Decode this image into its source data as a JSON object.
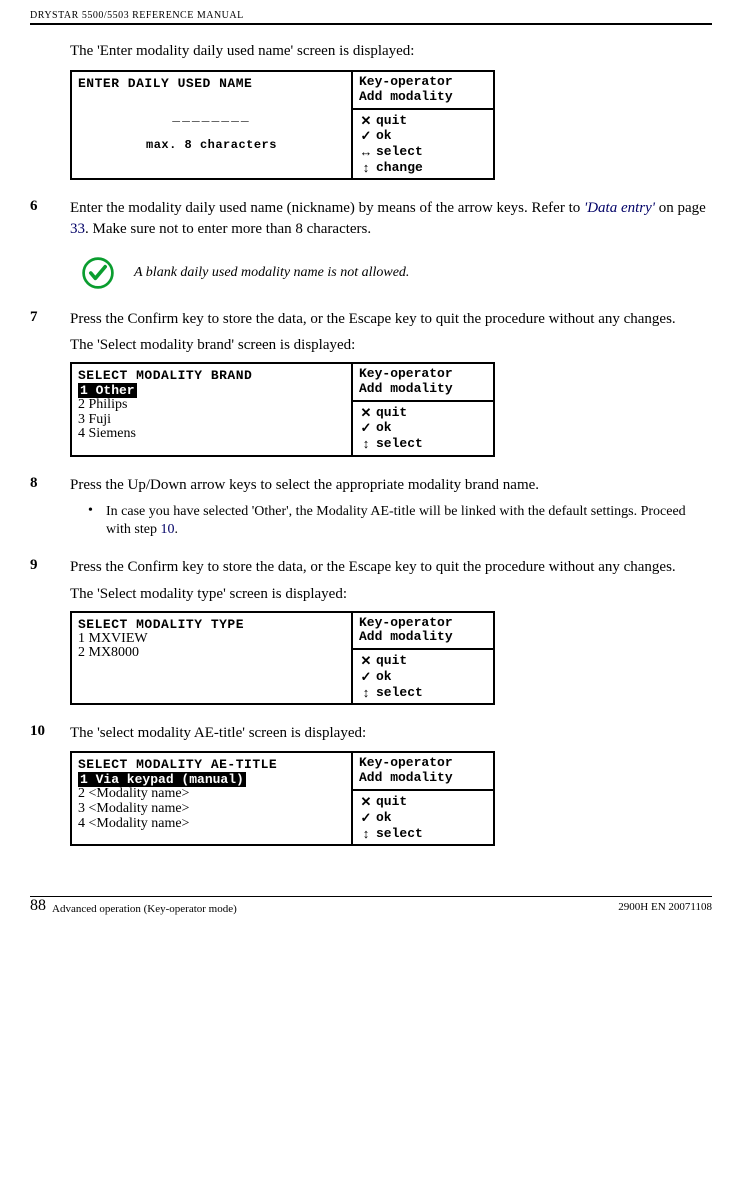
{
  "header": "DRYSTAR 5500/5503 REFERENCE MANUAL",
  "intro1": "The 'Enter modality daily used name' screen is displayed:",
  "lcd1": {
    "title": "ENTER DAILY USED NAME",
    "center": "________",
    "bottom": "max. 8 characters",
    "rtop": "Key-operator\nAdd modality",
    "actions": [
      "quit",
      "ok",
      "select",
      "change"
    ]
  },
  "step6": {
    "num": "6",
    "text_a": "Enter the modality daily used name (nickname) by means of the arrow keys. Refer to ",
    "link": "'Data entry'",
    "text_b": " on page ",
    "pagenum": "33",
    "text_c": ". Make sure not to enter more than 8 characters."
  },
  "note": "A blank daily used modality name is not allowed.",
  "step7": {
    "num": "7",
    "text": "Press the Confirm key to store the data, or the Escape key to quit the procedure without any changes.",
    "sub": "The 'Select modality brand' screen is displayed:"
  },
  "lcd2": {
    "title": "SELECT MODALITY BRAND",
    "selected": "1 Other",
    "items": [
      "2 Philips",
      "3 Fuji",
      "4 Siemens"
    ],
    "rtop": "Key-operator\nAdd modality",
    "actions": [
      "quit",
      "ok",
      "select"
    ]
  },
  "step8": {
    "num": "8",
    "text": "Press the Up/Down arrow keys to select the appropriate modality brand name.",
    "bullet_a": "In case you have selected 'Other', the Modality AE-title will be linked with the default settings. Proceed with step ",
    "bullet_link": "10",
    "bullet_b": "."
  },
  "step9": {
    "num": "9",
    "text": "Press the Confirm key to store the data, or the Escape key to quit the procedure without any changes.",
    "sub": "The 'Select modality type' screen is displayed:"
  },
  "lcd3": {
    "title": "SELECT MODALITY TYPE",
    "items": [
      "1 MXVIEW",
      "2 MX8000"
    ],
    "rtop": "Key-operator\nAdd modality",
    "actions": [
      "quit",
      "ok",
      "select"
    ]
  },
  "step10": {
    "num": "10",
    "text": "The 'select modality AE-title' screen is displayed:"
  },
  "lcd4": {
    "title": "SELECT MODALITY AE-TITLE",
    "selected": "1 Via keypad (manual)",
    "items": [
      "2 <Modality name>",
      "3 <Modality name>",
      "4 <Modality name>"
    ],
    "rtop": "Key-operator\nAdd modality",
    "actions": [
      "quit",
      "ok",
      "select"
    ]
  },
  "footer": {
    "pagenum": "88",
    "left": "Advanced operation (Key-operator mode)",
    "right": "2900H EN 20071108"
  },
  "symbols": {
    "x": "✕",
    "check": "✓",
    "lr": "↔",
    "ud": "↕"
  }
}
